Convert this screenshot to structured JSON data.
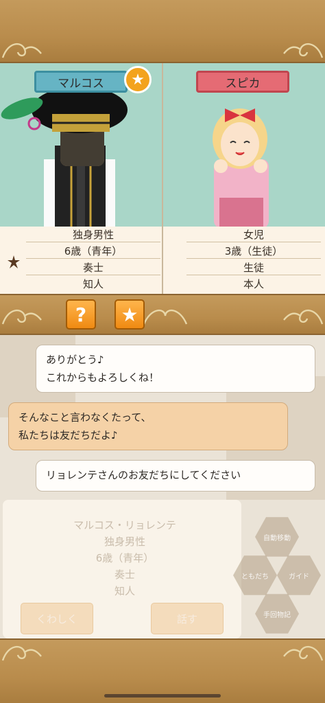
{
  "left_character": {
    "name": "マルコス",
    "info": [
      "独身男性",
      "6歳（青年）",
      "奏士",
      "知人"
    ],
    "favorite_icon": "star-icon",
    "row_icon": "flower-icon"
  },
  "right_character": {
    "name": "スピカ",
    "info": [
      "女児",
      "3歳（生徒）",
      "生徒",
      "本人"
    ]
  },
  "action_buttons": {
    "question_glyph": "?",
    "star_glyph": "★"
  },
  "chat": [
    {
      "speaker": "self",
      "text_lines": [
        "ありがとう♪",
        "これからもよろしくね！"
      ]
    },
    {
      "speaker": "other",
      "text_lines": [
        "そんなこと言わなくたって、",
        "私たちは友だちだよ♪"
      ]
    },
    {
      "speaker": "self",
      "text_lines": [
        "リョレンテさんのお友だちにしてください"
      ]
    }
  ],
  "background_card": {
    "title": "マルコス・リョレンテ",
    "info": [
      "独身男性",
      "6歳（青年）",
      "奏士",
      "知人"
    ],
    "details_button": "くわしく",
    "talk_button": "話す"
  },
  "background_menu": [
    "自動移動",
    "ともだち",
    "ガイド",
    "手回物記"
  ],
  "colors": {
    "wood": "#b98c4c",
    "panel_teal": "#a9d6c8",
    "left_tag": "#66b4c4",
    "right_tag": "#e56b74",
    "accent_orange": "#f3a31d"
  }
}
